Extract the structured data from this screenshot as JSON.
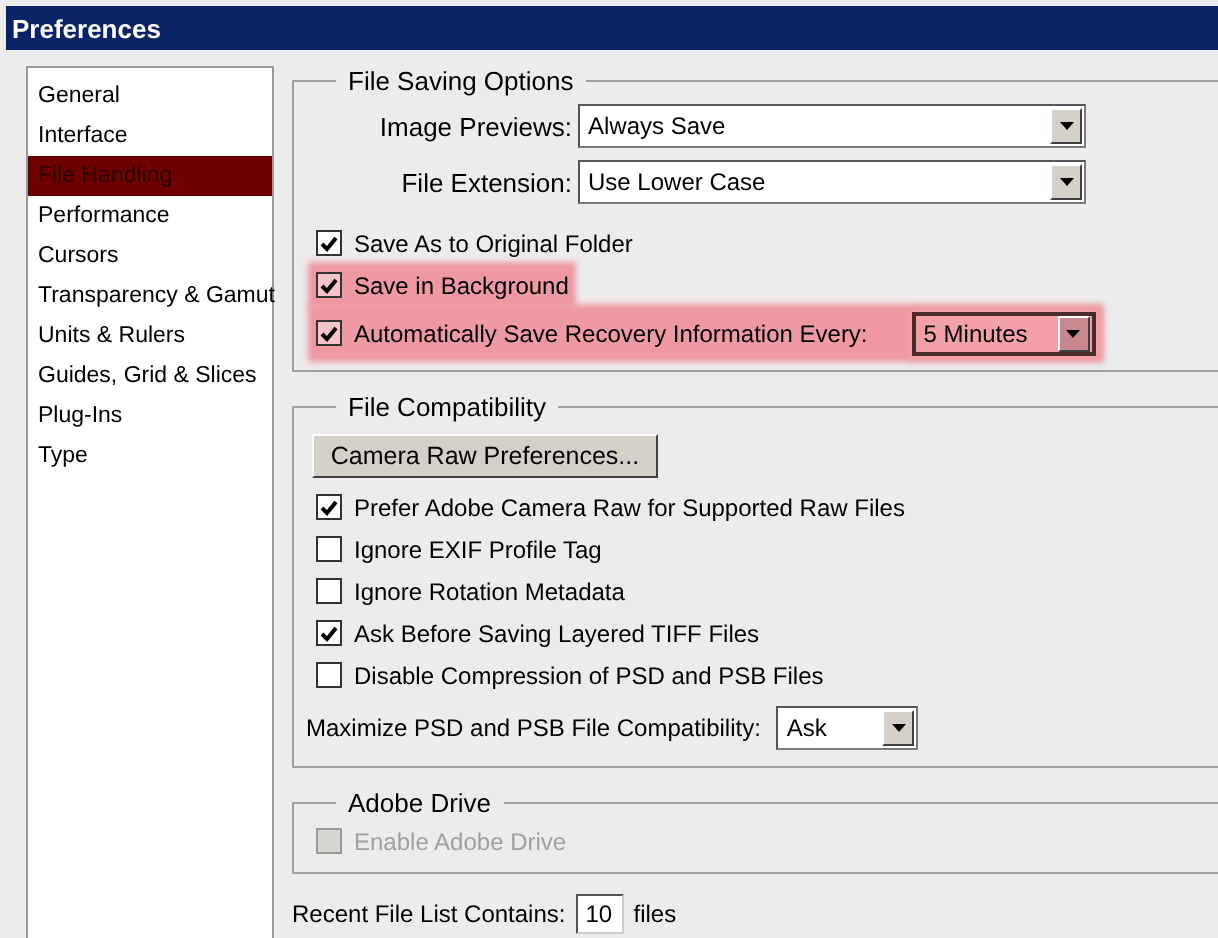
{
  "window": {
    "title": "Preferences"
  },
  "sidebar": {
    "items": [
      {
        "label": "General",
        "selected": false
      },
      {
        "label": "Interface",
        "selected": false
      },
      {
        "label": "File Handling",
        "selected": true
      },
      {
        "label": "Performance",
        "selected": false
      },
      {
        "label": "Cursors",
        "selected": false
      },
      {
        "label": "Transparency & Gamut",
        "selected": false
      },
      {
        "label": "Units & Rulers",
        "selected": false
      },
      {
        "label": "Guides, Grid & Slices",
        "selected": false
      },
      {
        "label": "Plug-Ins",
        "selected": false
      },
      {
        "label": "Type",
        "selected": false
      }
    ]
  },
  "file_saving_options": {
    "title": "File Saving Options",
    "selects": [
      {
        "label": "Image Previews:",
        "value": "Always Save"
      },
      {
        "label": "File Extension:",
        "value": "Use Lower Case"
      }
    ],
    "checkboxes": [
      {
        "label": "Save As to Original Folder",
        "checked": true,
        "disabled": false,
        "highlighted": false
      },
      {
        "label": "Save in Background",
        "checked": true,
        "disabled": false,
        "highlighted": true
      },
      {
        "label": "Automatically Save Recovery Information Every:",
        "checked": true,
        "disabled": false,
        "highlighted": true,
        "select": {
          "value": "5 Minutes"
        }
      }
    ]
  },
  "file_compatibility": {
    "title": "File Compatibility",
    "button": "Camera Raw Preferences...",
    "checkboxes": [
      {
        "label": "Prefer Adobe Camera Raw for Supported Raw Files",
        "checked": true,
        "disabled": false,
        "highlighted": false
      },
      {
        "label": "Ignore EXIF Profile Tag",
        "checked": false,
        "disabled": false,
        "highlighted": false
      },
      {
        "label": "Ignore Rotation Metadata",
        "checked": false,
        "disabled": false,
        "highlighted": false
      },
      {
        "label": "Ask Before Saving Layered TIFF Files",
        "checked": true,
        "disabled": false,
        "highlighted": false
      },
      {
        "label": "Disable Compression of PSD and PSB Files",
        "checked": false,
        "disabled": false,
        "highlighted": false
      }
    ],
    "select": {
      "label": "Maximize PSD and PSB File Compatibility:",
      "value": "Ask"
    }
  },
  "adobe_drive": {
    "title": "Adobe Drive",
    "checkboxes": [
      {
        "label": "Enable Adobe Drive",
        "checked": false,
        "disabled": true,
        "highlighted": false
      }
    ]
  },
  "recent_files": {
    "label": "Recent File List Contains:",
    "value": "10",
    "unit": "files"
  }
}
